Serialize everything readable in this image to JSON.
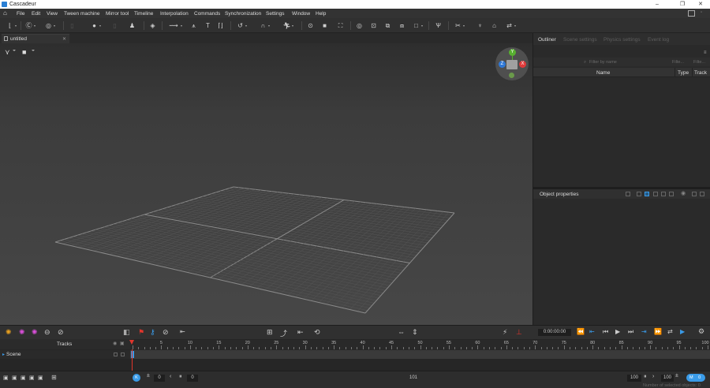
{
  "window": {
    "title": "Cascadeur",
    "minimize": "–",
    "maximize": "❐",
    "close": "✕"
  },
  "menu": [
    "File",
    "Edit",
    "View",
    "Tween machine",
    "Mirror tool",
    "Timeline",
    "Interpolation",
    "Commands",
    "Synchronization",
    "Settings",
    "Window",
    "Help"
  ],
  "document_tab": {
    "label": "untitled",
    "close": "✕"
  },
  "right_tabs": [
    "Outliner",
    "Scene settings",
    "Physics settings",
    "Event log"
  ],
  "outliner": {
    "filter_placeholder": "Filter by name",
    "filter2_placeholder": "Filte...",
    "filter3_placeholder": "Filte...",
    "columns": {
      "name": "Name",
      "type": "Type",
      "track": "Track"
    }
  },
  "object_properties": {
    "title": "Object properties"
  },
  "gizmo": {
    "y": "Y",
    "x": "X",
    "z": "Z"
  },
  "transport": {
    "time": "0:00:00:00"
  },
  "tracks": {
    "header": "Tracks",
    "scene_label": "Scene"
  },
  "ruler": {
    "labels": [
      5,
      10,
      15,
      20,
      25,
      30,
      35,
      40,
      45,
      50,
      55,
      60,
      65,
      70,
      75,
      80,
      85,
      90,
      95,
      100
    ],
    "max": 100
  },
  "bottom": {
    "key_label": "K",
    "frame_left": "0",
    "frame_right": "0",
    "current_frame": "101",
    "end_frame": "100",
    "end_frame2": "100",
    "fps_label": "M",
    "fps_value": "0",
    "status": "Number of selected objects: 0"
  },
  "colors": {
    "accent": "#3a9be8",
    "axis_x": "#e03a3a",
    "axis_y": "#58b030",
    "axis_z": "#2f78d6",
    "playhead": "#e0362c"
  }
}
